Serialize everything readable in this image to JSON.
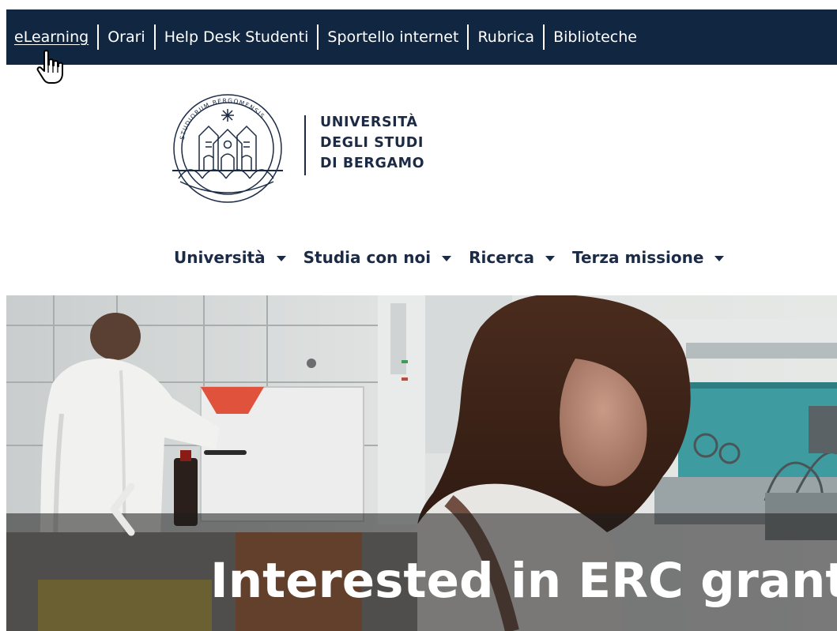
{
  "topbar": {
    "links": [
      {
        "label": "eLearning",
        "active": true
      },
      {
        "label": "Orari"
      },
      {
        "label": "Help Desk Studenti"
      },
      {
        "label": "Sportello internet"
      },
      {
        "label": "Rubrica"
      },
      {
        "label": "Biblioteche"
      }
    ]
  },
  "logo": {
    "line1": "UNIVERSITÀ",
    "line2": "DEGLI STUDI",
    "line3": "DI BERGAMO",
    "seal_text": "STUDIORUM BERGOMENSIS",
    "seal_icon": "university-seal"
  },
  "nav": {
    "items": [
      {
        "label": "Università"
      },
      {
        "label": "Studia con noi"
      },
      {
        "label": "Ricerca"
      },
      {
        "label": "Terza missione"
      }
    ]
  },
  "hero": {
    "caption": "Interested in ERC grants",
    "prev_icon": "chevron-left-icon"
  },
  "colors": {
    "topbar_bg": "#112640",
    "brand_navy": "#1b2a45"
  }
}
